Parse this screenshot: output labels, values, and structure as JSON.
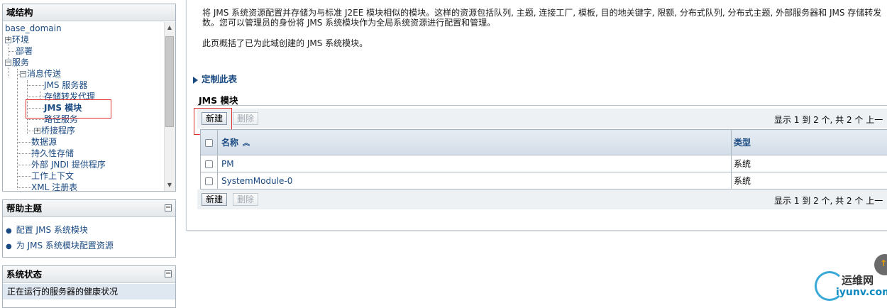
{
  "tree_panel": {
    "title": "域结构",
    "root": "base_domain",
    "items": [
      "环境",
      "部署",
      "服务",
      "消息传送",
      "JMS 服务器",
      "存储转发代理",
      "JMS 模块",
      "路径服务",
      "桥接程序",
      "数据源",
      "持久性存储",
      "外部 JNDI 提供程序",
      "工作上下文",
      "XML 注册表"
    ],
    "expand_plus": "+",
    "expand_minus": "−",
    "selected": "JMS 模块"
  },
  "help_panel": {
    "title": "帮助主题",
    "links": [
      "配置 JMS 系统模块",
      "为 JMS 系统模块配置资源"
    ]
  },
  "status_panel": {
    "title": "系统状态",
    "row": "正在运行的服务器的健康状况"
  },
  "collapse_symbol": "−",
  "intro": {
    "line1": "将 JMS 系统资源配置并存储为与标准 J2EE 模块相似的模块。这样的资源包括队列, 主题, 连接工厂, 模板, 目的地关键字, 限额, 分布式队列, 分布式主题, 外部服务器和 JMS 存储转发",
    "line2": "数。您可以管理员的身份将 JMS 系统模块作为全局系统资源进行配置和管理。",
    "line3": "此页概括了已为此域创建的 JMS 系统模块。"
  },
  "customize_link": "定制此表",
  "section_title": "JMS 模块",
  "toolbar": {
    "new_label": "新建",
    "delete_label": "删除",
    "pager_text": "显示 1 到 2 个, 共 2 个   上一"
  },
  "table": {
    "columns": [
      "名称",
      "类型"
    ],
    "rows": [
      {
        "name": "PM",
        "type": "系统"
      },
      {
        "name": "SystemModule-0",
        "type": "系统"
      }
    ]
  },
  "watermark": {
    "text1": "运维网",
    "text2": "iyunv.com"
  },
  "colors": {
    "link": "#1a4a82",
    "highlight_box": "#e03030",
    "header_bg": "#d3dde8"
  }
}
